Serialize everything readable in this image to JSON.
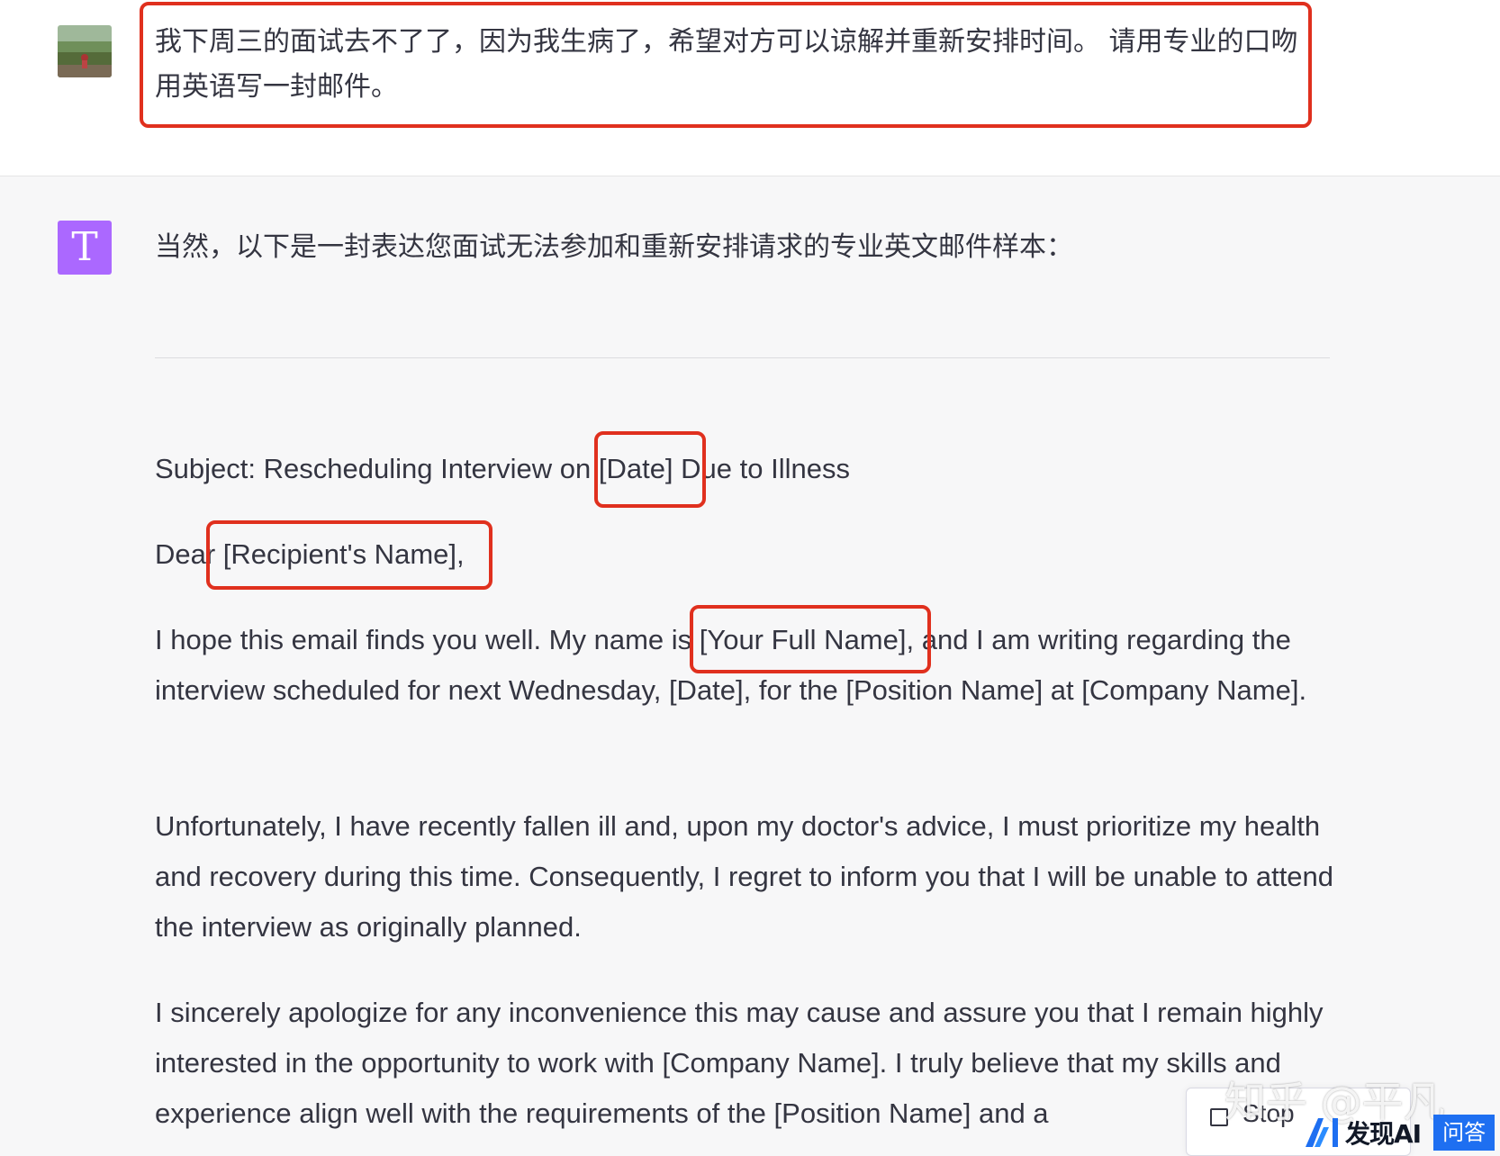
{
  "user_message": {
    "text": "我下周三的面试去不了了，因为我生病了，希望对方可以谅解并重新安排时间。 请用专业的口吻用英语写一封邮件。"
  },
  "assistant": {
    "avatar_letter": "T",
    "intro": "当然，以下是一封表达您面试无法参加和重新安排请求的专业英文邮件样本：",
    "email": {
      "subject": "Subject: Rescheduling Interview on [Date] Due to Illness",
      "greeting": "Dear [Recipient's Name],",
      "paragraphs": [
        "I hope this email finds you well. My name is [Your Full Name], and I am writing regarding the interview scheduled for next Wednesday, [Date], for the [Position Name] at [Company Name].",
        "Unfortunately, I have recently fallen ill and, upon my doctor's advice, I must prioritize my health and recovery during this time. Consequently, I regret to inform you that I will be unable to attend the interview as originally planned.",
        "I sincerely apologize for any inconvenience this may cause and assure you that I remain highly interested in the opportunity to work with [Company Name]. I truly believe that my skills and experience align well with the requirements of the [Position Name] and a"
      ]
    }
  },
  "controls": {
    "stop_label": "Stop"
  },
  "watermark": {
    "text": "知乎 @平凡"
  },
  "brand_badge": {
    "name": "发现AI",
    "tag": "问答"
  },
  "colors": {
    "highlight_border": "#e0301e",
    "assistant_avatar_bg": "#ab68ff",
    "text": "#343541",
    "page_bg": "#f7f7f8",
    "brand_blue": "#1e6ff1"
  }
}
